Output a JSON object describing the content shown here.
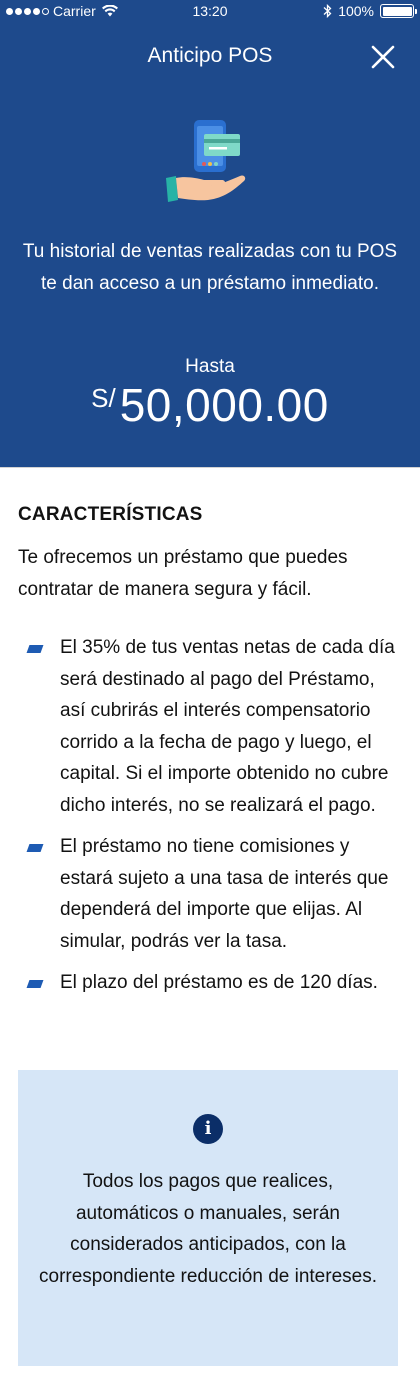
{
  "status_bar": {
    "carrier": "Carrier",
    "time": "13:20",
    "battery": "100%",
    "wifi_icon": "wifi-icon",
    "bluetooth_icon": "bluetooth-icon"
  },
  "header": {
    "title": "Anticipo POS",
    "close_icon": "close-icon",
    "illustration_icon": "hand-holding-phone-icon",
    "intro": "Tu historial de ventas realizadas con tu POS te dan acceso a un préstamo inmediato.",
    "hasta_label": "Hasta",
    "currency": "S/",
    "amount": "50,000.00",
    "background_color": "#1e4a8c"
  },
  "features": {
    "title": "CARACTERÍSTICAS",
    "description": "Te ofrecemos un préstamo que puedes contratar de manera segura y fácil.",
    "items": [
      "El 35% de tus ventas netas de cada día será destinado al pago del Préstamo, así cubrirás el interés compensatorio corrido a la fecha de pago y luego, el capital. Si el importe obtenido no cubre dicho interés, no se realizará el pago.",
      "El préstamo no tiene comisiones y estará sujeto a una tasa de interés que dependerá del importe que elijas. Al simular, podrás ver la tasa.",
      "El plazo del préstamo es de 120 días."
    ],
    "bullet_color": "#1e5bb3"
  },
  "info_box": {
    "icon": "info-icon",
    "icon_glyph": "i",
    "text": "Todos los pagos que realices, automáticos o manuales, serán considerados anticipados, con la correspondiente reducción de intereses.",
    "background_color": "#d6e6f7"
  }
}
